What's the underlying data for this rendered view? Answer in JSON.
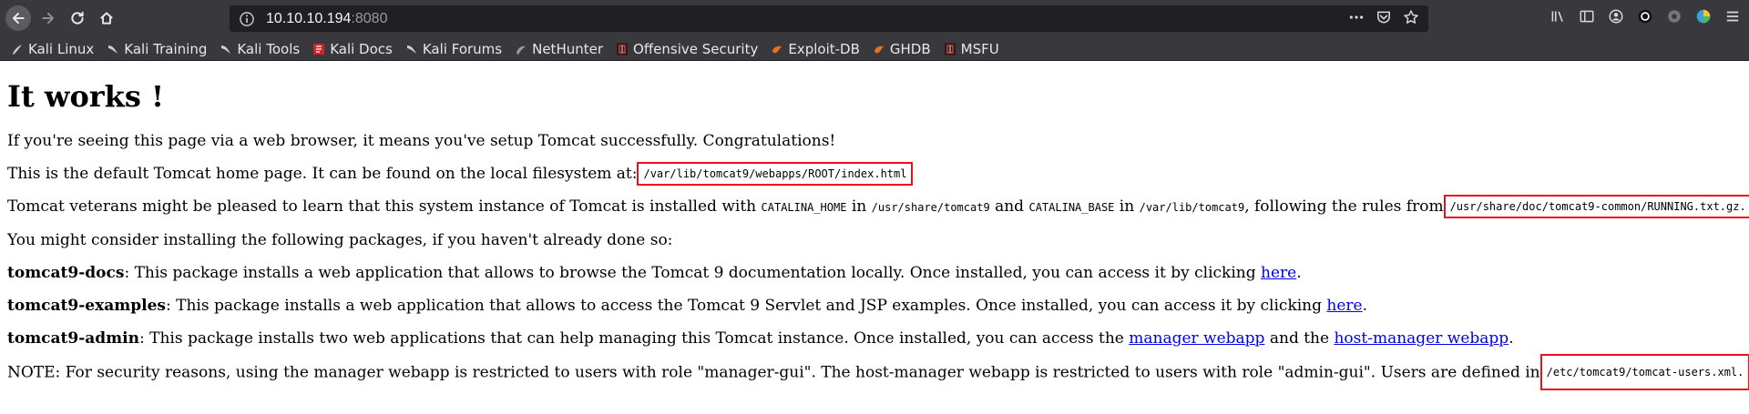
{
  "browser": {
    "url_host": "10.10.10.194",
    "url_port": ":8080"
  },
  "bookmarks": [
    {
      "label": "Kali Linux",
      "icon": "kali-dragon-icon"
    },
    {
      "label": "Kali Training",
      "icon": "kali-dragon-icon"
    },
    {
      "label": "Kali Tools",
      "icon": "kali-dragon-icon"
    },
    {
      "label": "Kali Docs",
      "icon": "kali-docs-icon"
    },
    {
      "label": "Kali Forums",
      "icon": "kali-dragon-icon"
    },
    {
      "label": "NetHunter",
      "icon": "nethunter-icon"
    },
    {
      "label": "Offensive Security",
      "icon": "offsec-icon"
    },
    {
      "label": "Exploit-DB",
      "icon": "exploitdb-icon"
    },
    {
      "label": "GHDB",
      "icon": "ghdb-icon"
    },
    {
      "label": "MSFU",
      "icon": "offsec-icon"
    }
  ],
  "page": {
    "title": "It works !",
    "p1": "If you're seeing this page via a web browser, it means you've setup Tomcat successfully. Congratulations!",
    "p2_text": "This is the default Tomcat home page. It can be found on the local filesystem at:",
    "p2_path": "/var/lib/tomcat9/webapps/ROOT/index.html",
    "p3_a": "Tomcat veterans might be pleased to learn that this system instance of Tomcat is installed with ",
    "p3_code1": "CATALINA_HOME",
    "p3_b": " in ",
    "p3_code2": "/usr/share/tomcat9",
    "p3_c": " and ",
    "p3_code3": "CATALINA_BASE",
    "p3_d": " in ",
    "p3_code4": "/var/lib/tomcat9",
    "p3_e": ", following the rules from",
    "p3_path": "/usr/share/doc/tomcat9-common/RUNNING.txt.gz.",
    "p4": "You might consider installing the following packages, if you haven't already done so:",
    "p5_name": "tomcat9-docs",
    "p5_text": ": This package installs a web application that allows to browse the Tomcat 9 documentation locally. Once installed, you can access it by clicking ",
    "p5_link": "here",
    "p5_end": ".",
    "p6_name": "tomcat9-examples",
    "p6_text": ": This package installs a web application that allows to access the Tomcat 9 Servlet and JSP examples. Once installed, you can access it by clicking ",
    "p6_link": "here",
    "p6_end": ".",
    "p7_name": "tomcat9-admin",
    "p7_text": ": This package installs two web applications that can help managing this Tomcat instance. Once installed, you can access the ",
    "p7_link1": "manager webapp",
    "p7_mid": " and the ",
    "p7_link2": "host-manager webapp",
    "p7_end": ".",
    "p8_text": "NOTE: For security reasons, using the manager webapp is restricted to users with role \"manager-gui\". The host-manager webapp is restricted to users with role \"admin-gui\". Users are defined in",
    "p8_path": "/etc/tomcat9/tomcat-users.xml."
  },
  "colors": {
    "chrome_bg": "#38383d",
    "urlbar_bg": "#202024",
    "highlight_box": "#e8101f",
    "link": "#0000ee"
  }
}
